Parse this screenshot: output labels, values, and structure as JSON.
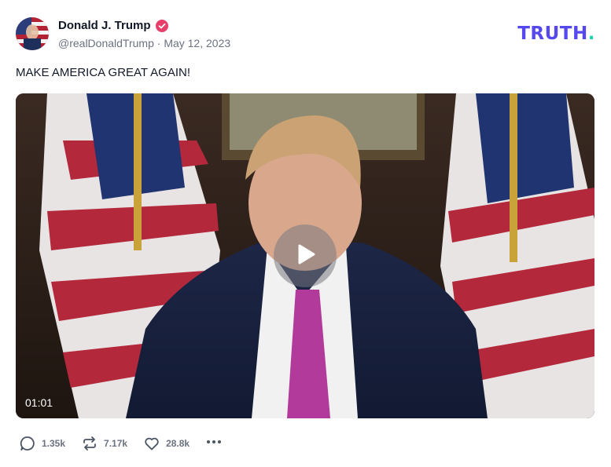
{
  "author": {
    "name": "Donald J. Trump",
    "verified": true,
    "handle": "@realDonaldTrump",
    "date": "May 12, 2023",
    "avatar_icon": "avatar-flag-portrait"
  },
  "brand": {
    "logo_text": "TRUTH",
    "logo_dot": ".",
    "color": "#5448ee",
    "dot_color": "#22d3b0"
  },
  "post": {
    "text": "MAKE AMERICA GREAT AGAIN!"
  },
  "video": {
    "duration": "01:01",
    "play_icon": "play-icon"
  },
  "actions": {
    "replies": "1.35k",
    "retruths": "7.17k",
    "likes": "28.8k",
    "reply_icon": "reply-icon",
    "retruth_icon": "retruth-icon",
    "like_icon": "heart-icon",
    "more_icon": "more-icon"
  }
}
